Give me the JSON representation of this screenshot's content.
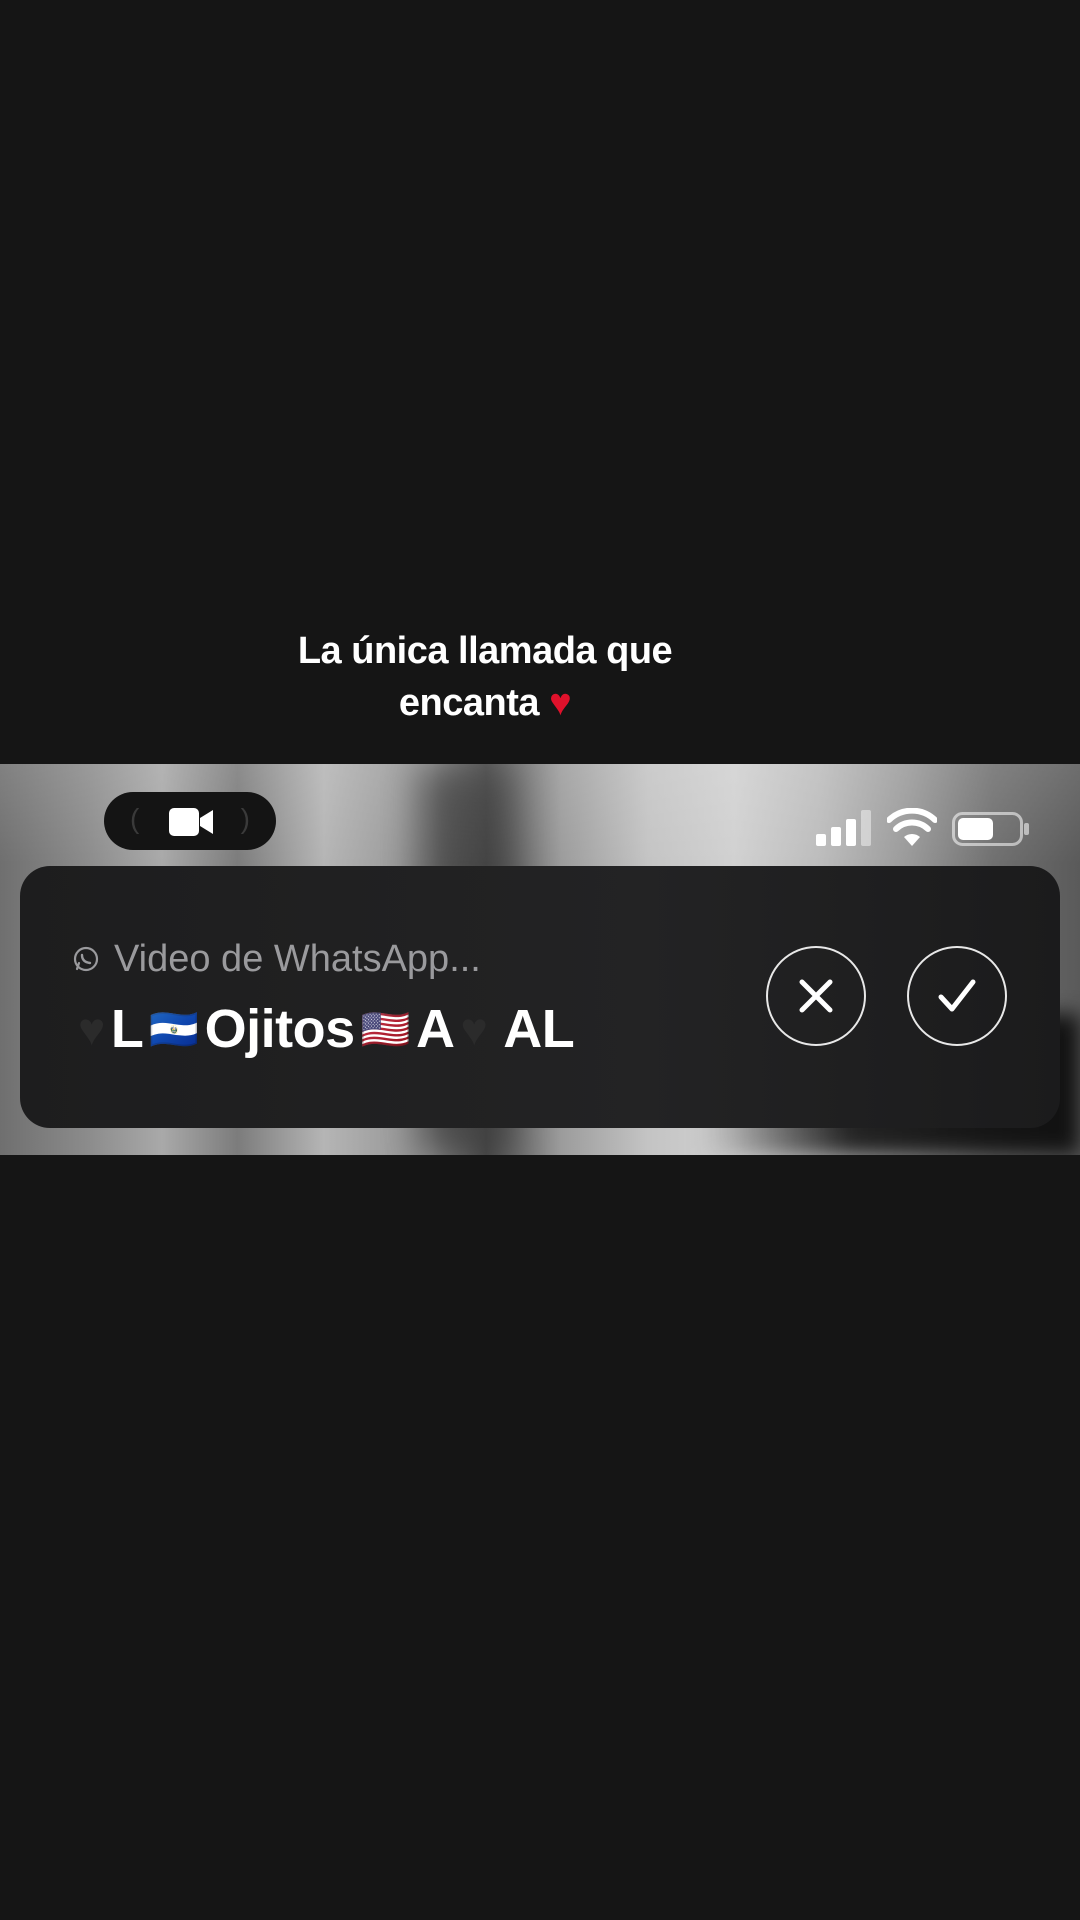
{
  "caption": {
    "line1": "La única llamada que",
    "line2": "encanta",
    "heart": "♥"
  },
  "status_bar": {
    "pill_icon": "video-camera-icon",
    "signal_icon": "cellular-signal-icon",
    "wifi_icon": "wifi-icon",
    "battery_icon": "battery-icon",
    "battery_level": 0.6
  },
  "call": {
    "app_icon": "whatsapp-icon",
    "app_label": "Video de WhatsApp...",
    "caller": {
      "heart1": "♥",
      "part1": "L",
      "flag1": "🇸🇻",
      "part2": "Ojitos",
      "flag2": "🇺🇸",
      "part3": "A",
      "heart2": "♥",
      "part4": "AL"
    },
    "decline_icon": "close-icon",
    "accept_icon": "checkmark-icon"
  },
  "colors": {
    "background": "#151515",
    "card": "#1f1f20",
    "heart_red": "#e0112b",
    "muted_text": "#9a9a9d"
  }
}
